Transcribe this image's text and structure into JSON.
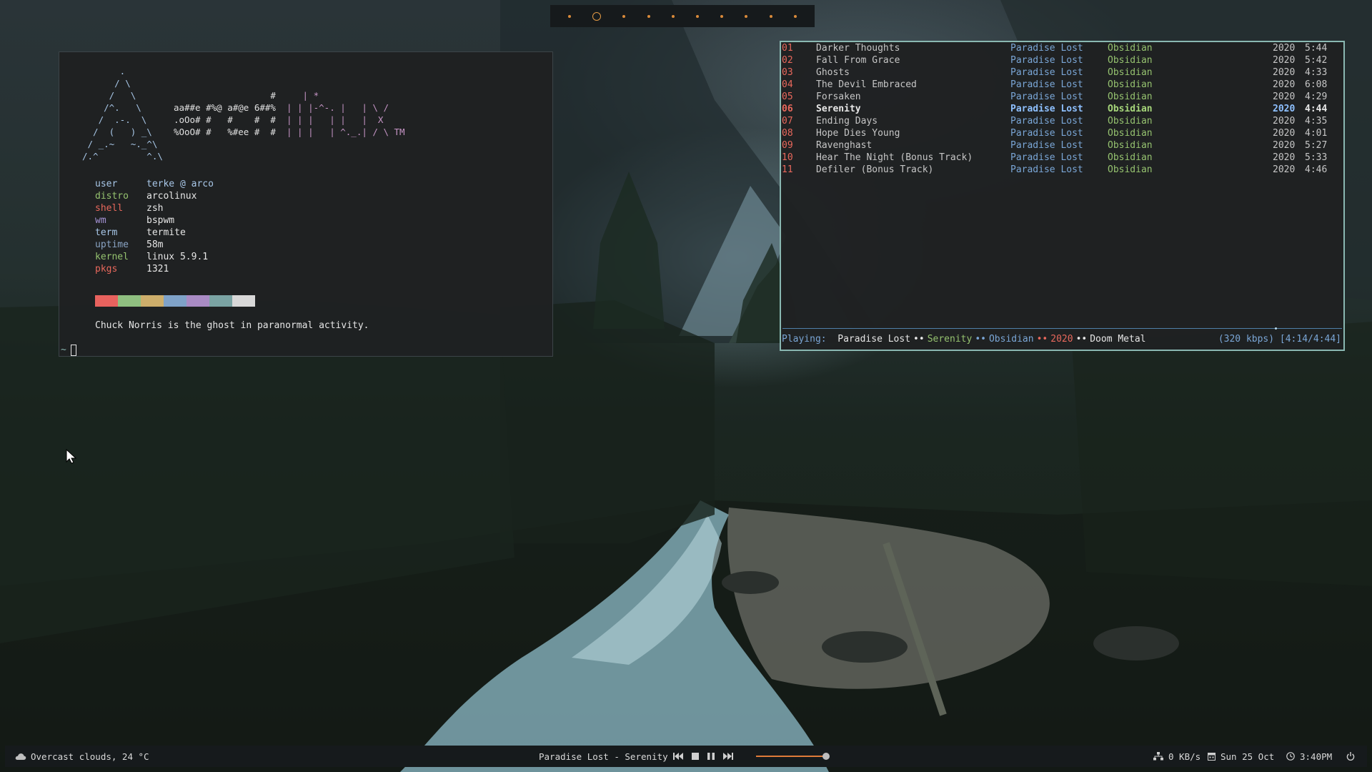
{
  "workspaces": {
    "count": 10,
    "active_index": 1,
    "accent_color": "#e39a45"
  },
  "fetch": {
    "ascii_logo": {
      "arch_lines": [
        "       .",
        "      / \\",
        "     /   \\",
        "    /^.   \\",
        "   /  .-.  \\",
        "  /  (   ) _\\",
        " / _.~   ~._^\\",
        "/.^         ^.\\"
      ],
      "word_lines": [
        "",
        "",
        "                  #     | *",
        "aa##e #%@ a#@e 6##%  | | |-^-. |   | \\ /",
        ".oOo# #   #    #  #  | | |   | |   |  X",
        "%OoO# #   %#ee #  #  | | |   | ^._.| / \\ TM"
      ]
    },
    "info": [
      {
        "key": "user",
        "value": "terke @ arco",
        "key_color": "#a8c7e8",
        "value_color": "#a8c7e8"
      },
      {
        "key": "distro",
        "value": "arcolinux",
        "key_color": "#95c26f",
        "value_color": "#e6e6e6"
      },
      {
        "key": "shell",
        "value": "zsh",
        "key_color": "#e8685c",
        "value_color": "#e6e6e6"
      },
      {
        "key": "wm",
        "value": "bspwm",
        "key_color": "#a593d6",
        "value_color": "#e6e6e6"
      },
      {
        "key": "term",
        "value": "termite",
        "key_color": "#a8c7e8",
        "value_color": "#e6e6e6"
      },
      {
        "key": "uptime",
        "value": "58m",
        "key_color": "#8aa4c4",
        "value_color": "#e6e6e6"
      },
      {
        "key": "kernel",
        "value": "linux 5.9.1",
        "key_color": "#95c26f",
        "value_color": "#e6e6e6"
      },
      {
        "key": "pkgs",
        "value": "1321",
        "key_color": "#e8685c",
        "value_color": "#e6e6e6"
      }
    ],
    "palette": [
      "#e8625e",
      "#8fbf80",
      "#cdae6b",
      "#7fa2c8",
      "#a98bc4",
      "#7aa3a3",
      "#d8d8d8"
    ],
    "quote": "Chuck Norris is the ghost in paranormal activity.",
    "prompt": "~"
  },
  "playlist": {
    "tracks": [
      {
        "num": "01",
        "title": "Darker Thoughts",
        "artist": "Paradise Lost",
        "album": "Obsidian",
        "year": "2020",
        "time": "5:44"
      },
      {
        "num": "02",
        "title": "Fall From Grace",
        "artist": "Paradise Lost",
        "album": "Obsidian",
        "year": "2020",
        "time": "5:42"
      },
      {
        "num": "03",
        "title": "Ghosts",
        "artist": "Paradise Lost",
        "album": "Obsidian",
        "year": "2020",
        "time": "4:33"
      },
      {
        "num": "04",
        "title": "The Devil Embraced",
        "artist": "Paradise Lost",
        "album": "Obsidian",
        "year": "2020",
        "time": "6:08"
      },
      {
        "num": "05",
        "title": "Forsaken",
        "artist": "Paradise Lost",
        "album": "Obsidian",
        "year": "2020",
        "time": "4:29"
      },
      {
        "num": "06",
        "title": "Serenity",
        "artist": "Paradise Lost",
        "album": "Obsidian",
        "year": "2020",
        "time": "4:44",
        "current": true
      },
      {
        "num": "07",
        "title": "Ending Days",
        "artist": "Paradise Lost",
        "album": "Obsidian",
        "year": "2020",
        "time": "4:35"
      },
      {
        "num": "08",
        "title": "Hope Dies Young",
        "artist": "Paradise Lost",
        "album": "Obsidian",
        "year": "2020",
        "time": "4:01"
      },
      {
        "num": "09",
        "title": "Ravenghast",
        "artist": "Paradise Lost",
        "album": "Obsidian",
        "year": "2020",
        "time": "5:27"
      },
      {
        "num": "10",
        "title": "Hear The Night (Bonus Track)",
        "artist": "Paradise Lost",
        "album": "Obsidian",
        "year": "2020",
        "time": "5:33"
      },
      {
        "num": "11",
        "title": "Defiler (Bonus Track)",
        "artist": "Paradise Lost",
        "album": "Obsidian",
        "year": "2020",
        "time": "4:46"
      }
    ],
    "progress_fraction": 0.88,
    "status": {
      "label": "Playing:",
      "artist": "Paradise Lost",
      "title": "Serenity",
      "album": "Obsidian",
      "year": "2020",
      "genre": "Doom Metal",
      "separator": "••",
      "bitrate": "(320 kbps) [4:14/4:44]"
    }
  },
  "bottom_bar": {
    "weather": "Overcast clouds, 24 °C",
    "now_playing": "Paradise Lost - Serenity",
    "volume_fraction": 0.92,
    "network": "0 KB/s",
    "date": "Sun 25 Oct",
    "time": "3:40PM",
    "icons": [
      "cloud-icon",
      "prev-track-icon",
      "stop-icon",
      "pause-icon",
      "next-track-icon",
      "network-icon",
      "calendar-icon",
      "clock-icon",
      "power-icon"
    ]
  }
}
